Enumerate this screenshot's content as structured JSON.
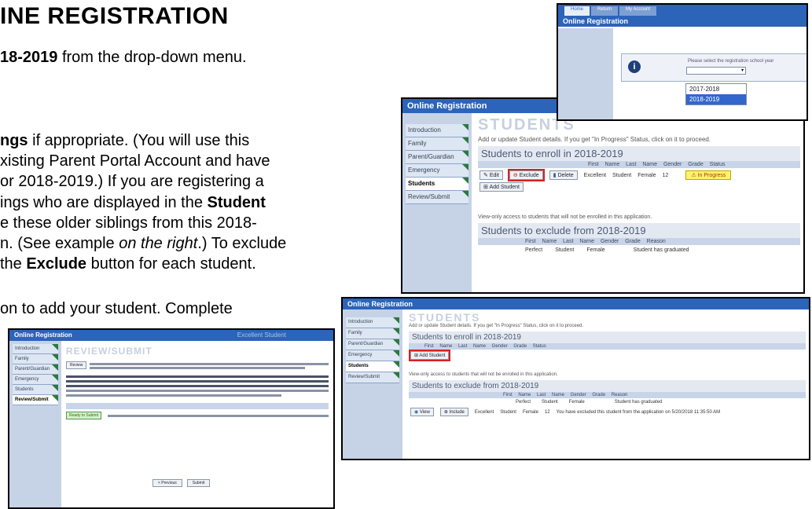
{
  "doc": {
    "heading": "INE REGISTRATION",
    "line1_bold": "18-2019",
    "line1_rest": " from the drop-down menu.",
    "p2_l1_bold": "ngs",
    "p2_l1_rest": " if appropriate.  (You will use this",
    "p2_l2": "xisting Parent Portal Account and have",
    "p2_l3": "or 2018-2019.) If you are registering a",
    "p2_l4_a": "ings who are displayed in the ",
    "p2_l4_bold": "Student",
    "p2_l5": "e these older siblings from this 2018-",
    "p2_l6_a": "n. (See example ",
    "p2_l6_it": "on the right",
    "p2_l6_b": ".) To exclude",
    "p2_l7_a": " the ",
    "p2_l7_bold": "Exclude",
    "p2_l7_b": " button for each student.",
    "p3_l1": "on to add your student. Complete"
  },
  "shot1": {
    "tabs": [
      "Home",
      "Return",
      "My Account"
    ],
    "title": "Online Registration",
    "prompt": "Please select the registration school year",
    "options": [
      "2017-2018",
      "2018-2019"
    ],
    "selected": "2018-2019"
  },
  "shot2": {
    "title": "Online Registration",
    "nav": [
      "Introduction",
      "Family",
      "Parent/Guardian",
      "Emergency",
      "Students",
      "Review/Submit"
    ],
    "active": "Students",
    "heading": "STUDENTS",
    "instructions": "Add or update Student details. If you get \"In Progress\" Status, click on it to proceed.",
    "enroll_title": "Students to enroll in 2018-2019",
    "columns": "First Name  Last Name  Gender  Grade  Status",
    "row": {
      "edit": "Edit",
      "exclude": "Exclude",
      "delete": "Delete",
      "first": "Excellent",
      "last": "Student",
      "gender": "Female",
      "grade": "12",
      "status": "In Progress"
    },
    "add": "Add Student",
    "note": "View-only access to students that will not be enrolled in this application.",
    "exclude_title": "Students to exclude from 2018-2019",
    "ex_columns": "First Name  Last Name  Gender  Grade  Reason",
    "ex_row": {
      "first": "Perfect",
      "last": "Student",
      "gender": "Female",
      "reason": "Student has graduated"
    }
  },
  "shot3": {
    "title": "Online Registration",
    "nav": [
      "Introduction",
      "Family",
      "Parent/Guardian",
      "Emergency",
      "Students",
      "Review/Submit"
    ],
    "active": "Students",
    "heading": "STUDENTS",
    "instructions": "Add or update Student details. If you get \"In Progress\" Status, click on it to proceed.",
    "enroll_title": "Students to enroll in 2018-2019",
    "columns": "First Name  Last Name  Gender  Grade  Status",
    "add": "Add Student",
    "note": "View-only access to students that will not be enrolled in this application.",
    "exclude_title": "Students to exclude from 2018-2019",
    "ex_columns": "First Name  Last Name  Gender  Grade  Reason",
    "ex_rows": [
      {
        "first": "Perfect",
        "last": "Student",
        "gender": "Female",
        "grade": "",
        "reason": "Student has graduated"
      },
      {
        "first": "Excellent",
        "last": "Student",
        "gender": "Female",
        "grade": "12",
        "reason": "You have excluded this student from the application on 5/20/2018 11:35:50 AM"
      }
    ],
    "view": "View",
    "include": "Include"
  },
  "shot4": {
    "title": "Online Registration",
    "nav": [
      "Introduction",
      "Family",
      "Parent/Guardian",
      "Emergency",
      "Students",
      "Review/Submit"
    ],
    "heading": "REVIEW/SUBMIT",
    "prev": "< Previous",
    "submit": "Submit",
    "ready": "Ready to Submit"
  }
}
